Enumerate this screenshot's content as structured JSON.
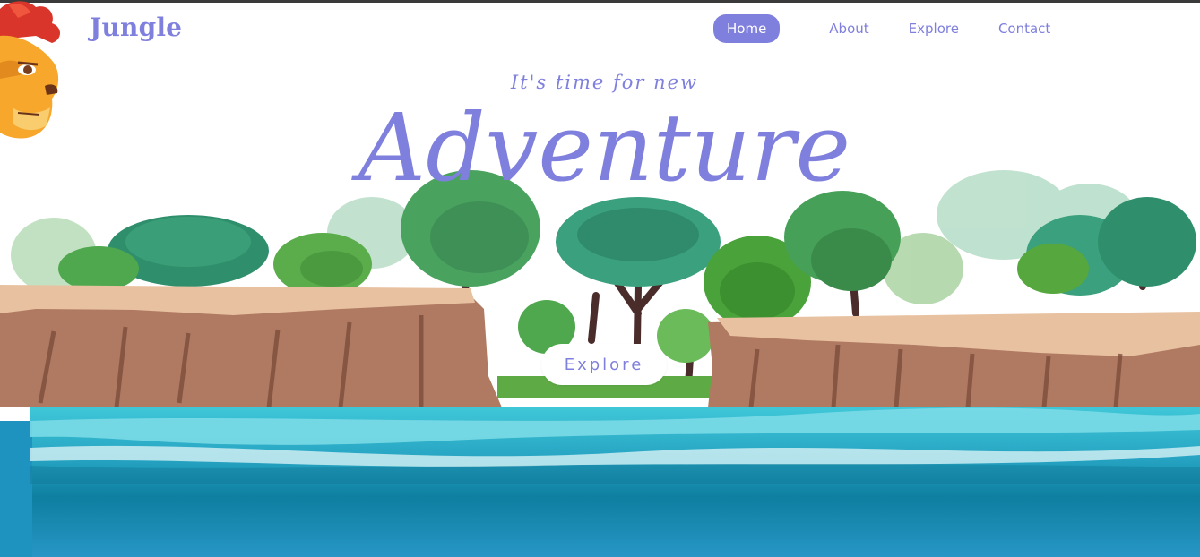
{
  "brand": {
    "name": "Jungle"
  },
  "nav": {
    "items": [
      {
        "label": "Home",
        "active": true
      },
      {
        "label": "About",
        "active": false
      },
      {
        "label": "Explore",
        "active": false
      },
      {
        "label": "Contact",
        "active": false
      }
    ]
  },
  "hero": {
    "tagline": "It's time for new",
    "headline": "Adventure",
    "cta_label": "Explore"
  },
  "icons": {
    "mascot": "lion-mascot-icon"
  },
  "colors": {
    "accent": "#7f7fdd",
    "cliff": "#b07a62",
    "cliff_top": "#e8c1a0",
    "water": "#2a9cc4",
    "foliage": "#3f9a5b"
  }
}
